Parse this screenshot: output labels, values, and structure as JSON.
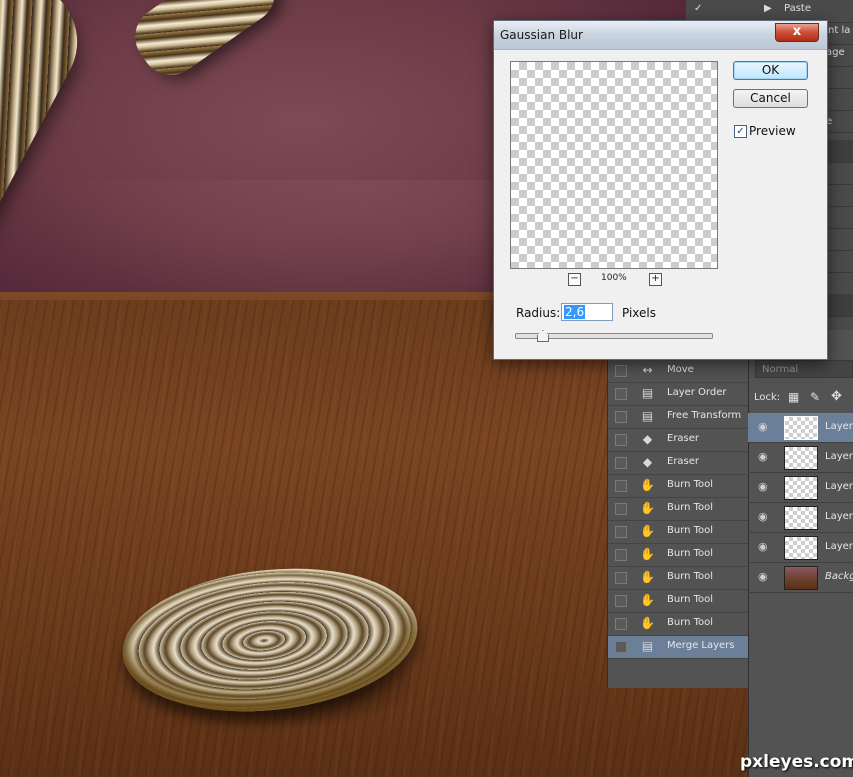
{
  "dialog": {
    "title": "Gaussian Blur",
    "ok_label": "OK",
    "cancel_label": "Cancel",
    "preview_label": "Preview",
    "preview_checked": "✓",
    "zoom_out": "−",
    "zoom_in": "+",
    "zoom_value": "100%",
    "radius_label": "Radius:",
    "radius_value": "2,6",
    "radius_unit": "Pixels",
    "close_glyph": "x"
  },
  "top_panel": {
    "items": [
      {
        "label": "Paste"
      },
      {
        "label": "rent la"
      },
      {
        "label": "age"
      },
      {
        "label": "e"
      }
    ]
  },
  "history": {
    "items": [
      {
        "label": "Move",
        "icon": "move-icon",
        "glyph": "↔"
      },
      {
        "label": "Layer Order",
        "icon": "document-icon",
        "glyph": "▤"
      },
      {
        "label": "Free Transform",
        "icon": "document-icon",
        "glyph": "▤"
      },
      {
        "label": "Eraser",
        "icon": "eraser-icon",
        "glyph": "◆"
      },
      {
        "label": "Eraser",
        "icon": "eraser-icon",
        "glyph": "◆"
      },
      {
        "label": "Burn Tool",
        "icon": "burn-tool-icon",
        "glyph": "✋"
      },
      {
        "label": "Burn Tool",
        "icon": "burn-tool-icon",
        "glyph": "✋"
      },
      {
        "label": "Burn Tool",
        "icon": "burn-tool-icon",
        "glyph": "✋"
      },
      {
        "label": "Burn Tool",
        "icon": "burn-tool-icon",
        "glyph": "✋"
      },
      {
        "label": "Burn Tool",
        "icon": "burn-tool-icon",
        "glyph": "✋"
      },
      {
        "label": "Burn Tool",
        "icon": "burn-tool-icon",
        "glyph": "✋"
      },
      {
        "label": "Burn Tool",
        "icon": "burn-tool-icon",
        "glyph": "✋"
      },
      {
        "label": "Merge Layers",
        "icon": "document-icon",
        "glyph": "▤",
        "active": true
      }
    ]
  },
  "layers": {
    "blend_mode": "Normal",
    "lock_label": "Lock:",
    "items": [
      {
        "name": "Layer",
        "selected": true
      },
      {
        "name": "Layer"
      },
      {
        "name": "Layer"
      },
      {
        "name": "Layer"
      },
      {
        "name": "Layer"
      },
      {
        "name": "Backgr",
        "background": true
      }
    ]
  },
  "watermark": "pxleyes.com"
}
